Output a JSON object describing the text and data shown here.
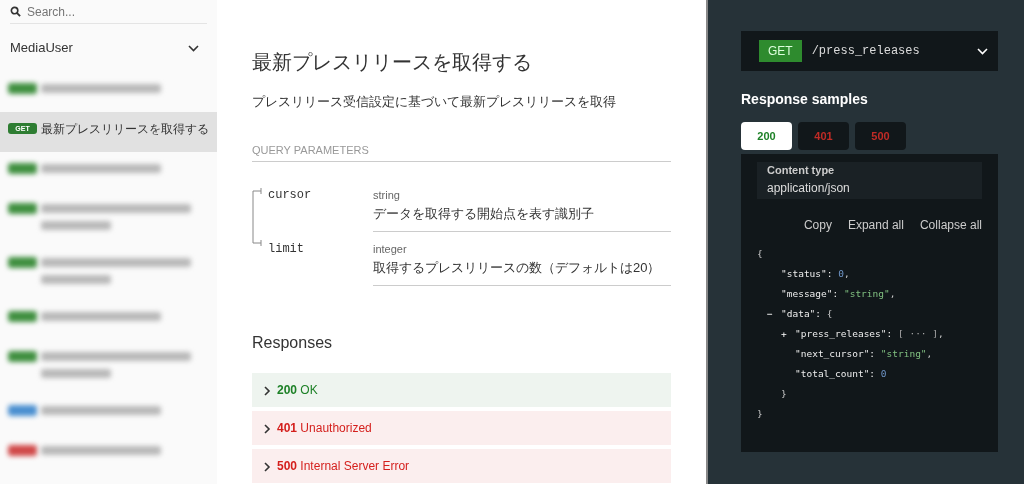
{
  "sidebar": {
    "search": {
      "placeholder": "Search..."
    },
    "group": {
      "label": "MediaUser",
      "expanded": true
    },
    "items": [
      {
        "kind": "blurred",
        "color": "#3f8f3f",
        "wrap": false,
        "selected": false
      },
      {
        "kind": "text",
        "method": "GET",
        "color": "#2e7d32",
        "label": "最新プレスリリースを取得する",
        "selected": true
      },
      {
        "kind": "blurred",
        "color": "#3f8f3f",
        "wrap": false,
        "selected": false
      },
      {
        "kind": "blurred",
        "color": "#3f8f3f",
        "wrap": true,
        "selected": false
      },
      {
        "kind": "blurred",
        "color": "#3f8f3f",
        "wrap": true,
        "selected": false
      },
      {
        "kind": "blurred",
        "color": "#3f8f3f",
        "wrap": false,
        "selected": false
      },
      {
        "kind": "blurred",
        "color": "#3f8f3f",
        "wrap": true,
        "selected": false
      },
      {
        "kind": "blurred",
        "color": "#4a8fd0",
        "wrap": false,
        "selected": false
      },
      {
        "kind": "blurred",
        "color": "#d04848",
        "wrap": false,
        "selected": false
      }
    ]
  },
  "operation": {
    "title": "最新プレスリリースを取得する",
    "description": "プレスリリース受信設定に基づいて最新プレスリリースを取得",
    "params_heading": "QUERY PARAMETERS",
    "params": [
      {
        "name": "cursor",
        "type": "string",
        "description": "データを取得する開始点を表す識別子"
      },
      {
        "name": "limit",
        "type": "integer",
        "description": "取得するプレスリリースの数（デフォルトは20）"
      }
    ],
    "responses_heading": "Responses",
    "responses": [
      {
        "kind": "success",
        "code": "200",
        "text": "OK"
      },
      {
        "kind": "error",
        "code": "401",
        "text": "Unauthorized"
      },
      {
        "kind": "error",
        "code": "500",
        "text": "Internal Server Error"
      }
    ]
  },
  "samples": {
    "method": "GET",
    "path": "/press_releases",
    "heading": "Response samples",
    "tabs": [
      {
        "label": "200",
        "kind": "success",
        "selected": true
      },
      {
        "label": "401",
        "kind": "error",
        "selected": false
      },
      {
        "label": "500",
        "kind": "error",
        "selected": false
      }
    ],
    "content_type_label": "Content type",
    "content_type": "application/json",
    "actions": [
      "Copy",
      "Expand all",
      "Collapse all"
    ],
    "body": {
      "open": "{",
      "close": "}",
      "children": [
        {
          "key": "\"status\":",
          "value": "0",
          "kind": "number",
          "trail": ","
        },
        {
          "key": "\"message\":",
          "value": "\"string\"",
          "kind": "string",
          "trail": ","
        },
        {
          "toggle": "−",
          "key": "\"data\":",
          "open": "{",
          "close": "}",
          "children": [
            {
              "toggle": "+",
              "key": "\"press_releases\":",
              "value": "[ ··· ]",
              "kind": "collapsed",
              "trail": ","
            },
            {
              "key": "\"next_cursor\":",
              "value": "\"string\"",
              "kind": "string",
              "trail": ","
            },
            {
              "key": "\"total_count\":",
              "value": "0",
              "kind": "number"
            }
          ]
        }
      ]
    }
  }
}
